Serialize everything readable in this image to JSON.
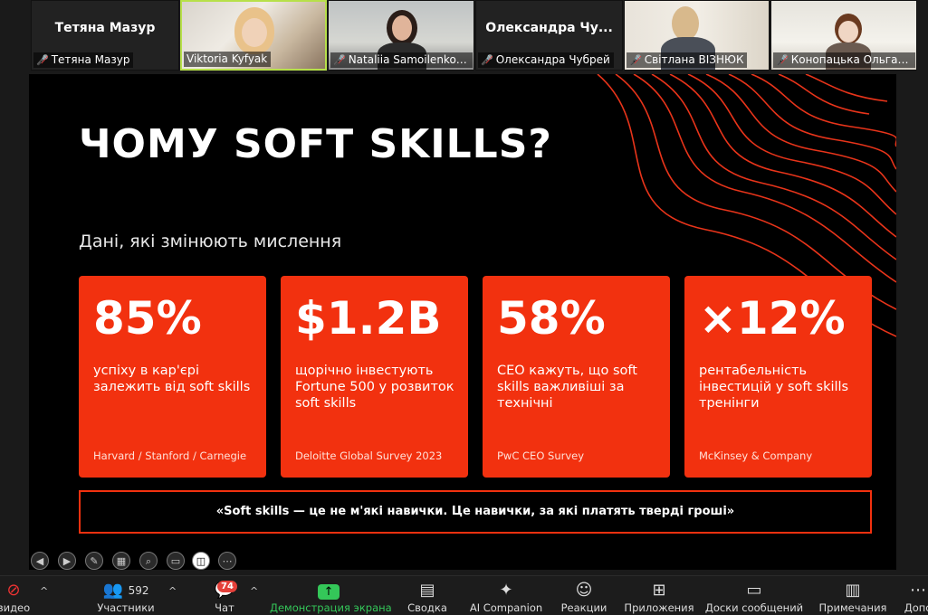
{
  "participants": [
    {
      "id": "t1",
      "display": "Тетяна Мазур",
      "label": "Тетяна Мазур",
      "muted": true,
      "video": false
    },
    {
      "id": "t2",
      "label": "Viktoria Kyfyak",
      "muted": false,
      "video": true,
      "active": true
    },
    {
      "id": "t3",
      "label": "Nataliia Samoilenko ...",
      "muted": true,
      "video": true
    },
    {
      "id": "t4",
      "display": "Олександра  Чу...",
      "label": "Олександра Чубрей",
      "muted": true,
      "video": false
    },
    {
      "id": "t5",
      "label": "Світлана ВІЗНЮК",
      "muted": true,
      "video": true
    },
    {
      "id": "t6",
      "label": "Конопацька Ольга Г...",
      "muted": true,
      "video": true
    }
  ],
  "slide": {
    "title": "ЧОМУ SOFT SKILLS?",
    "subtitle": "Дані, які змінюють мислення",
    "cards": [
      {
        "num": "85%",
        "desc": "успіху в кар'єрі залежить від soft skills",
        "src": "Harvard / Stanford / Carnegie"
      },
      {
        "num": "$1.2B",
        "desc": "щорічно інвестують Fortune 500 у розвиток soft skills",
        "src": "Deloitte Global Survey 2023"
      },
      {
        "num": "58%",
        "desc": "CEO кажуть, що soft skills важливіші за технічні",
        "src": "PwC CEO Survey"
      },
      {
        "num": "×12%",
        "desc": "рентабельність інвестицій у soft skills тренінги",
        "src": "McKinsey & Company"
      }
    ],
    "quote": "«Soft skills — це не м'які навички. Це навички, за які платять тверді гроші»",
    "accent": "#f2310f"
  },
  "toolbar": {
    "video_label": "видео",
    "participants_label": "Участники",
    "participants_count": "592",
    "chat_label": "Чат",
    "chat_badge": "74",
    "share_label": "Демонстрация экрана",
    "summary_label": "Сводка",
    "ai_label": "AI Companion",
    "reactions_label": "Реакции",
    "apps_label": "Приложения",
    "boards_label": "Доски сообщений",
    "notes_label": "Примечания",
    "more_label": "Допо"
  }
}
